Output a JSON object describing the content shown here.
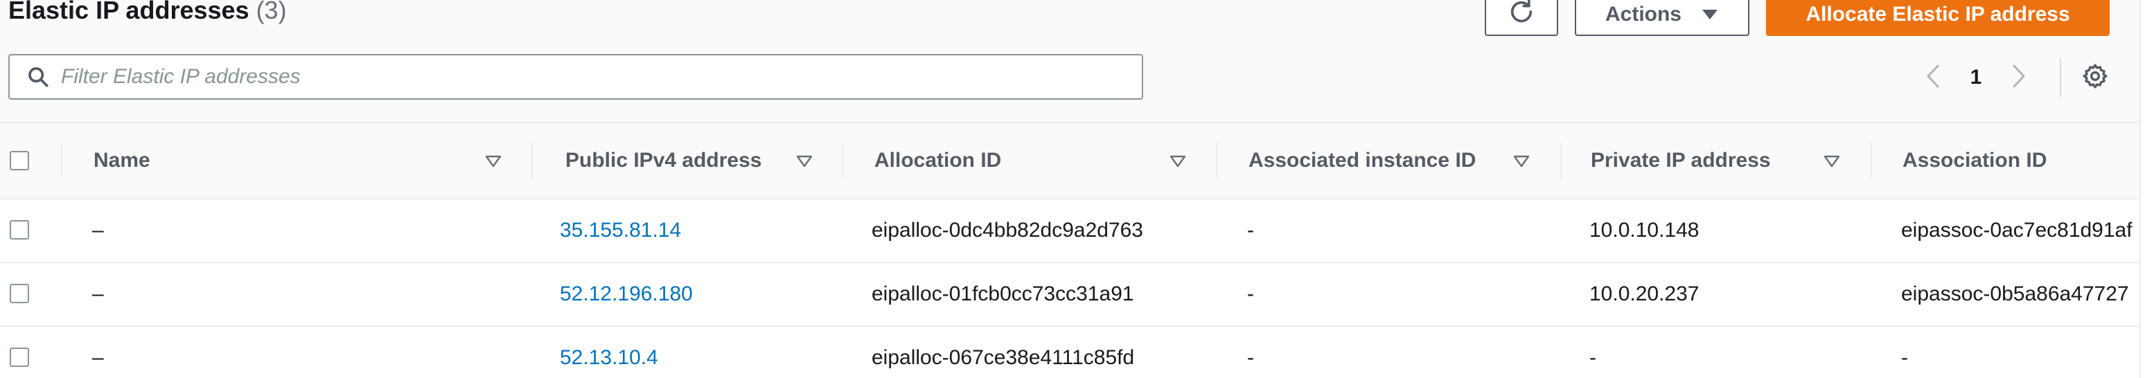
{
  "header": {
    "title": "Elastic IP addresses",
    "count": "(3)",
    "actions_label": "Actions",
    "allocate_label": "Allocate Elastic IP address",
    "refresh_icon": "refresh-icon",
    "caret_icon": "caret-down-icon"
  },
  "search": {
    "placeholder": "Filter Elastic IP addresses",
    "value": "",
    "icon": "search-icon"
  },
  "pagination": {
    "current_page": "1",
    "prev_icon": "chevron-left-icon",
    "next_icon": "chevron-right-icon",
    "settings_icon": "gear-icon"
  },
  "table": {
    "columns": [
      {
        "key": "name",
        "label": "Name"
      },
      {
        "key": "public_ip",
        "label": "Public IPv4 address"
      },
      {
        "key": "allocation_id",
        "label": "Allocation ID"
      },
      {
        "key": "instance_id",
        "label": "Associated instance ID"
      },
      {
        "key": "private_ip",
        "label": "Private IP address"
      },
      {
        "key": "association_id",
        "label": "Association ID"
      }
    ],
    "rows": [
      {
        "name": "–",
        "public_ip": "35.155.81.14",
        "allocation_id": "eipalloc-0dc4bb82dc9a2d763",
        "instance_id": "-",
        "private_ip": "10.0.10.148",
        "association_id": "eipassoc-0ac7ec81d91af"
      },
      {
        "name": "–",
        "public_ip": "52.12.196.180",
        "allocation_id": "eipalloc-01fcb0cc73cc31a91",
        "instance_id": "-",
        "private_ip": "10.0.20.237",
        "association_id": "eipassoc-0b5a86a47727"
      },
      {
        "name": "–",
        "public_ip": "52.13.10.4",
        "allocation_id": "eipalloc-067ce38e4111c85fd",
        "instance_id": "-",
        "private_ip": "-",
        "association_id": "-"
      }
    ]
  },
  "colors": {
    "primary": "#ec7211",
    "link": "#0073bb",
    "text": "#16191f",
    "muted": "#545b64"
  }
}
